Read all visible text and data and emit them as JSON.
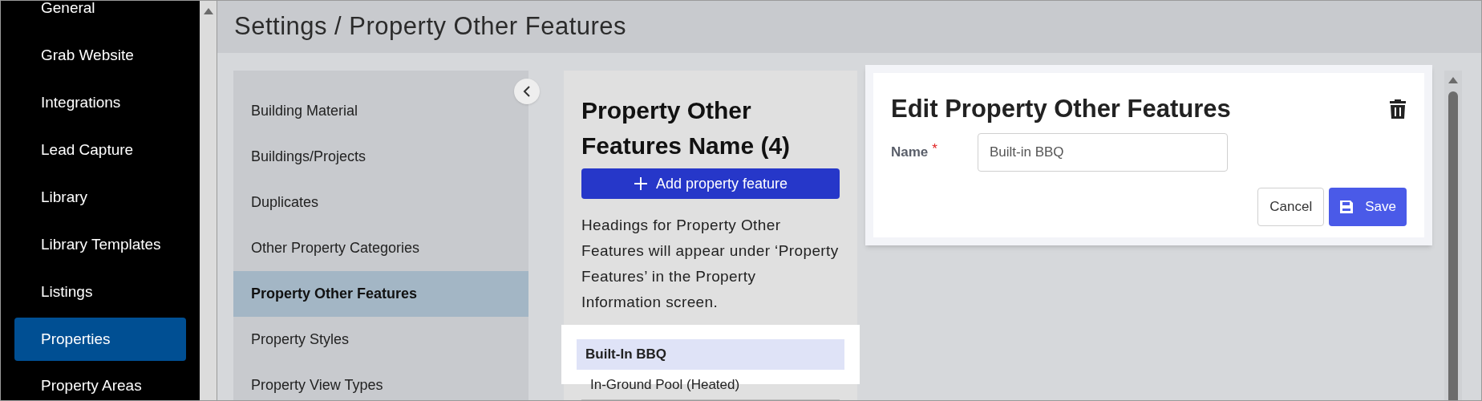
{
  "sidebar": {
    "items": [
      {
        "label": "General",
        "selected": false
      },
      {
        "label": "Grab Website",
        "selected": false
      },
      {
        "label": "Integrations",
        "selected": false
      },
      {
        "label": "Lead Capture",
        "selected": false
      },
      {
        "label": "Library",
        "selected": false
      },
      {
        "label": "Library Templates",
        "selected": false
      },
      {
        "label": "Listings",
        "selected": false
      },
      {
        "label": "Properties",
        "selected": true
      },
      {
        "label": "Property Areas",
        "selected": false
      }
    ]
  },
  "header": {
    "title": "Settings / Property Other Features"
  },
  "settings_list": {
    "items": [
      {
        "label": "Building Material",
        "selected": false
      },
      {
        "label": "Buildings/Projects",
        "selected": false
      },
      {
        "label": "Duplicates",
        "selected": false
      },
      {
        "label": "Other Property Categories",
        "selected": false
      },
      {
        "label": "Property Other Features",
        "selected": true
      },
      {
        "label": "Property Styles",
        "selected": false
      },
      {
        "label": "Property View Types",
        "selected": false
      }
    ]
  },
  "features_panel": {
    "title": "Property Other Features Name (4)",
    "add_button": "Add property feature",
    "description": "Headings for Property Other Features will appear under ‘Property Features’ in the Property Information screen.",
    "items": [
      {
        "label": "Built-In BBQ",
        "selected": true
      },
      {
        "label": "In-Ground Pool (Heated)",
        "selected": false
      }
    ]
  },
  "edit_panel": {
    "title": "Edit Property Other Features",
    "field": {
      "label": "Name",
      "required_mark": "*",
      "value": "Built-in BBQ"
    },
    "buttons": {
      "cancel": "Cancel",
      "save": "Save"
    }
  }
}
